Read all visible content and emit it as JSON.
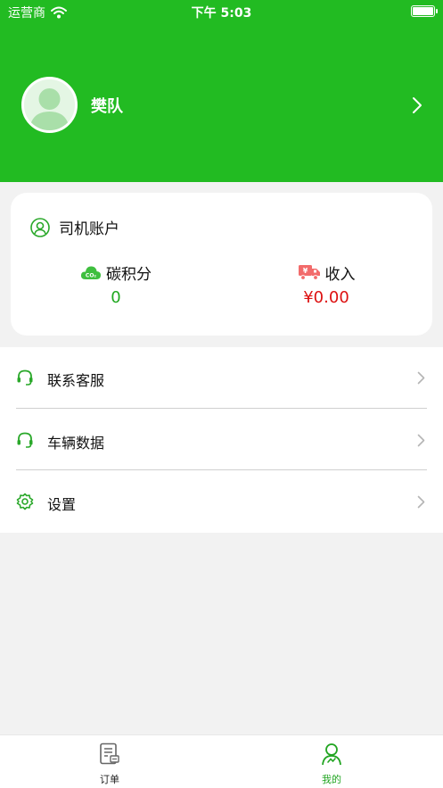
{
  "status_bar": {
    "carrier": "运营商",
    "time": "下午 5:03"
  },
  "profile": {
    "name": "樊队"
  },
  "account_card": {
    "title": "司机账户",
    "carbon_label": "碳积分",
    "carbon_value": "0",
    "income_label": "收入",
    "income_value": "¥0.00"
  },
  "menu": [
    {
      "label": "联系客服",
      "icon": "headset-icon"
    },
    {
      "label": "车辆数据",
      "icon": "headset-icon"
    },
    {
      "label": "设置",
      "icon": "gear-icon"
    }
  ],
  "tabs": [
    {
      "label": "订单",
      "icon": "order-icon",
      "active": false
    },
    {
      "label": "我的",
      "icon": "person-icon",
      "active": true
    }
  ],
  "colors": {
    "brand": "#22bb22",
    "accent_text": "#1fa81f",
    "income": "#dd1111",
    "background": "#f2f2f2"
  }
}
